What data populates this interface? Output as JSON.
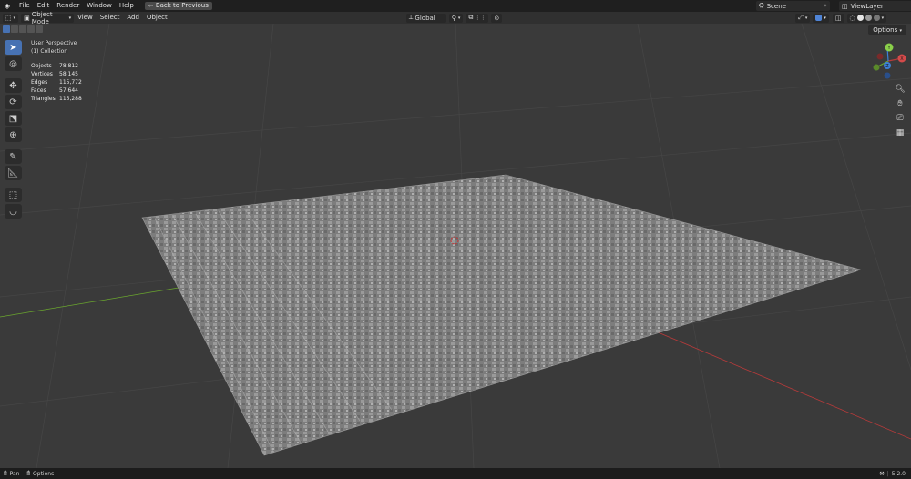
{
  "menubar": {
    "items": [
      "File",
      "Edit",
      "Render",
      "Window",
      "Help"
    ],
    "back_label": "Back to Previous",
    "scene": "Scene",
    "view_layer": "ViewLayer"
  },
  "header": {
    "mode": "Object Mode",
    "menus": [
      "View",
      "Select",
      "Add",
      "Object"
    ],
    "orientation": "Global"
  },
  "viewport": {
    "perspective": "User Perspective",
    "collection": "(1) Collection",
    "stats": [
      {
        "label": "Objects",
        "value": "78,812"
      },
      {
        "label": "Vertices",
        "value": "58,145"
      },
      {
        "label": "Edges",
        "value": "115,772"
      },
      {
        "label": "Faces",
        "value": "57,644"
      },
      {
        "label": "Triangles",
        "value": "115,288"
      }
    ],
    "options_label": "Options",
    "gizmo": {
      "x": "X",
      "y": "Y",
      "z": "Z"
    }
  },
  "statusbar": {
    "pan": "Pan",
    "options": "Options",
    "version": "5.2.0"
  },
  "colors": {
    "accent": "#4772b3",
    "x_axis": "#b83a3a",
    "y_axis": "#6aa62e",
    "z_axis": "#3d7fd6"
  }
}
